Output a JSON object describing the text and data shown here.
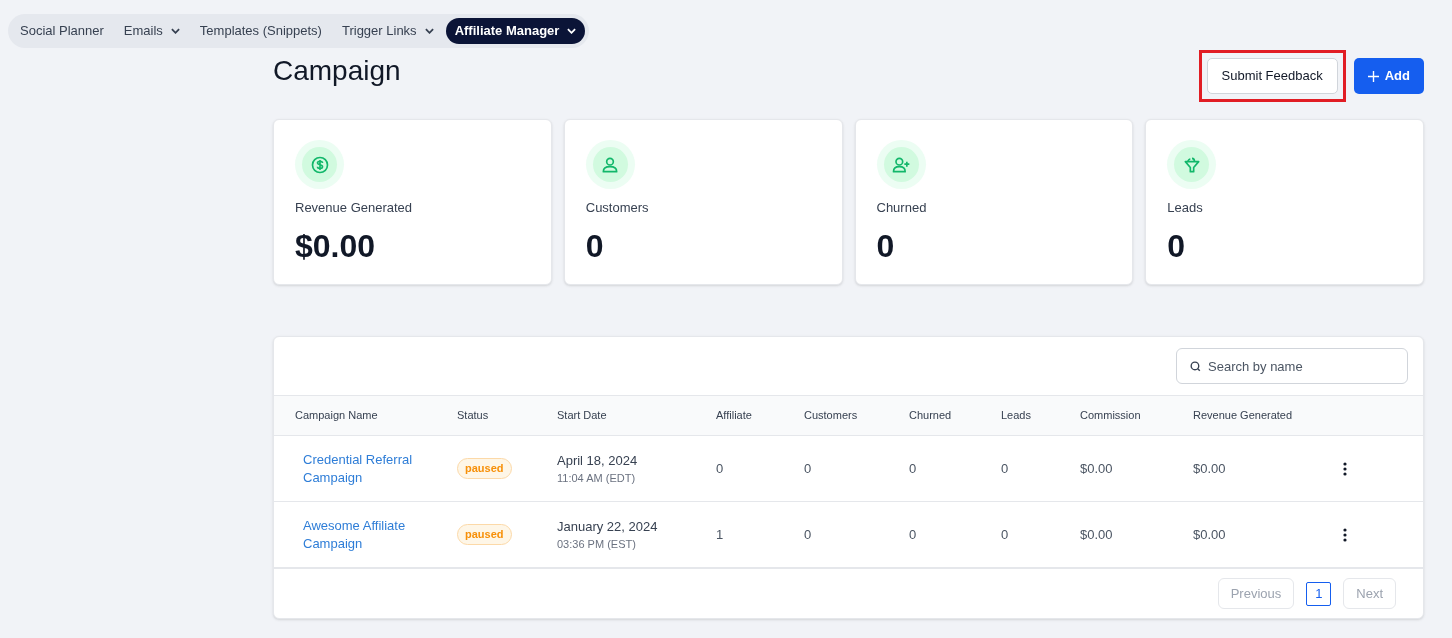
{
  "nav_tabs": [
    {
      "label": "Social Planner",
      "dropdown": false,
      "selected": false
    },
    {
      "label": "Emails",
      "dropdown": true,
      "selected": false
    },
    {
      "label": "Templates (Snippets)",
      "dropdown": false,
      "selected": false
    },
    {
      "label": "Trigger Links",
      "dropdown": true,
      "selected": false
    },
    {
      "label": "Affiliate Manager",
      "dropdown": true,
      "selected": true
    }
  ],
  "page_title": "Campaign",
  "header_buttons": [
    {
      "label": "Submit Feedback",
      "kind": "outline",
      "highlighted": true
    },
    {
      "label": "Add",
      "kind": "primary",
      "highlighted": false
    }
  ],
  "stats": [
    {
      "kind": "money",
      "label": "Revenue Generated",
      "value": "$0.00"
    },
    {
      "kind": "person",
      "label": "Customers",
      "value": "0"
    },
    {
      "kind": "person-plus",
      "label": "Churned",
      "value": "0"
    },
    {
      "kind": "funnel",
      "label": "Leads",
      "value": "0"
    }
  ],
  "table": {
    "search": {
      "placeholder": "Search by name"
    },
    "columns": [
      "Campaign Name",
      "Status",
      "Start Date",
      "Affiliate",
      "Customers",
      "Churned",
      "Leads",
      "Commission",
      "Revenue Generated"
    ],
    "rows": [
      {
        "name": "Credential Referral Campaign",
        "status": "paused",
        "date": "April 18, 2024",
        "time": "11:04 AM (EDT)",
        "affiliate": "0",
        "customers": "0",
        "churned": "0",
        "leads": "0",
        "commission": "$0.00",
        "revenue": "$0.00"
      },
      {
        "name": "Awesome Affiliate Campaign",
        "status": "paused",
        "date": "January 22, 2024",
        "time": "03:36 PM (EST)",
        "affiliate": "1",
        "customers": "0",
        "churned": "0",
        "leads": "0",
        "commission": "$0.00",
        "revenue": "$0.00"
      }
    ]
  },
  "pagination": {
    "previous": {
      "label": "Previous",
      "disabled": true
    },
    "pages": [
      {
        "label": "1",
        "selected": true
      }
    ],
    "next": {
      "label": "Next",
      "disabled": true
    }
  }
}
